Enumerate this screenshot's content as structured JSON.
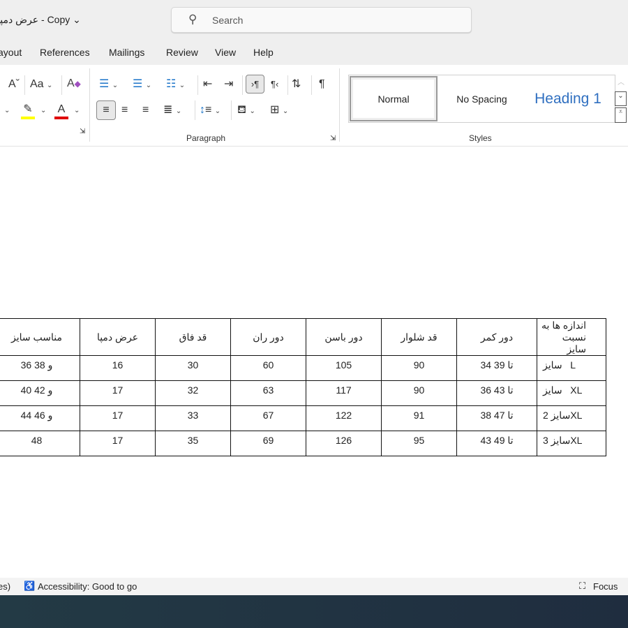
{
  "window": {
    "title": "عرض دمپا - Copy",
    "search_placeholder": "Search"
  },
  "tabs": [
    "ayout",
    "References",
    "Mailings",
    "Review",
    "View",
    "Help"
  ],
  "ribbon": {
    "groups": {
      "paragraph": "Paragraph",
      "styles": "Styles"
    },
    "styles": [
      {
        "label": "Normal",
        "selected": true
      },
      {
        "label": "No Spacing"
      },
      {
        "label": "Heading 1",
        "color": "#2f6fc0"
      }
    ],
    "colors": {
      "highlight": "#ffff00",
      "font_color": "#e00000",
      "accent": "#1a73c8"
    }
  },
  "table": {
    "headers": [
      "مناسب سایز",
      "عرض دمپا",
      "قد فاق",
      "دور ران",
      "دور باسن",
      "قد شلوار",
      "دور کمر",
      "اندازه ها به نسبت سایز"
    ],
    "rows": [
      [
        "36 و 38",
        "16",
        "30",
        "60",
        "105",
        "90",
        "34 تا 39",
        "سایز   L"
      ],
      [
        "40 و 42",
        "17",
        "32",
        "63",
        "117",
        "90",
        "36 تا 43",
        "سایز   XL"
      ],
      [
        "44 و 46",
        "17",
        "33",
        "67",
        "122",
        "91",
        "38 تا 47",
        "سایز 2XL"
      ],
      [
        "48",
        "17",
        "35",
        "69",
        "126",
        "95",
        "43 تا 49",
        "سایز 3XL"
      ]
    ]
  },
  "status": {
    "left_fragment": "es)",
    "accessibility": "Accessibility: Good to go",
    "focus": "Focus"
  }
}
